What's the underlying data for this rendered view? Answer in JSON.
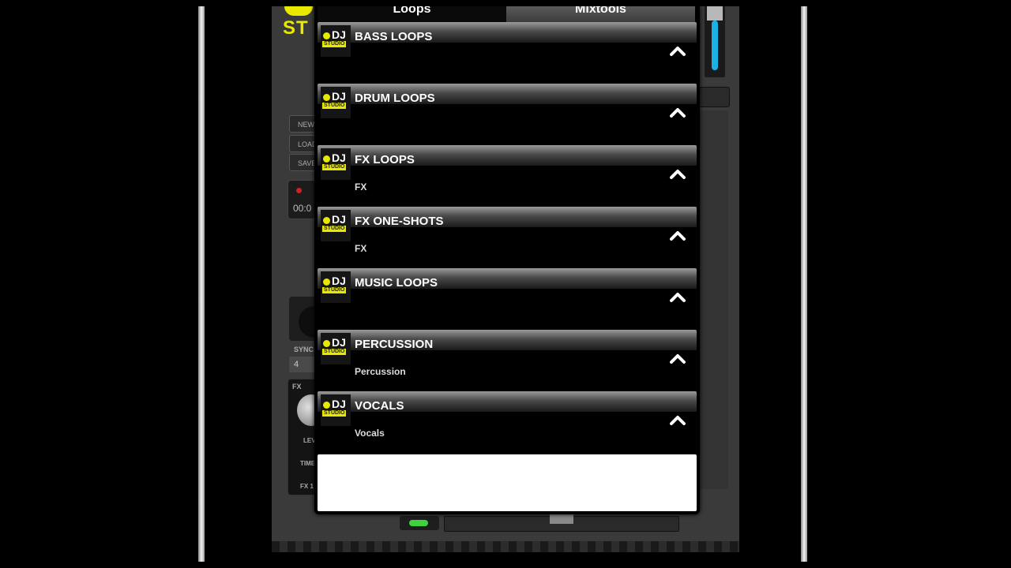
{
  "background_app": {
    "logo_text": "STUDIO",
    "logo_text_visible": "ST",
    "side_buttons": [
      "NEW",
      "LOAD",
      "SAVE"
    ],
    "record_label": "REC",
    "record_time": "00:0",
    "sync_label": "SYNC",
    "sync_value": "4",
    "fx_label": "FX",
    "fx_controls": [
      "LEVEL",
      "TIME",
      "FX 1"
    ],
    "volume_slider_level": 0.75,
    "accent_color": "#1ab2e6",
    "brand_color": "#e8e800"
  },
  "popup": {
    "tabs": [
      {
        "label": "Loops",
        "active": true
      },
      {
        "label": "Mixtools",
        "active": false
      }
    ],
    "icon_brand": {
      "dj": "DJ",
      "studio": "STUDIO"
    },
    "categories": [
      {
        "title": "BASS LOOPS",
        "subtitle": ""
      },
      {
        "title": "DRUM LOOPS",
        "subtitle": ""
      },
      {
        "title": "FX LOOPS",
        "subtitle": "FX"
      },
      {
        "title": "FX ONE-SHOTS",
        "subtitle": "FX"
      },
      {
        "title": "MUSIC LOOPS",
        "subtitle": ""
      },
      {
        "title": "PERCUSSION",
        "subtitle": "Percussion"
      },
      {
        "title": "VOCALS",
        "subtitle": "Vocals"
      }
    ]
  }
}
